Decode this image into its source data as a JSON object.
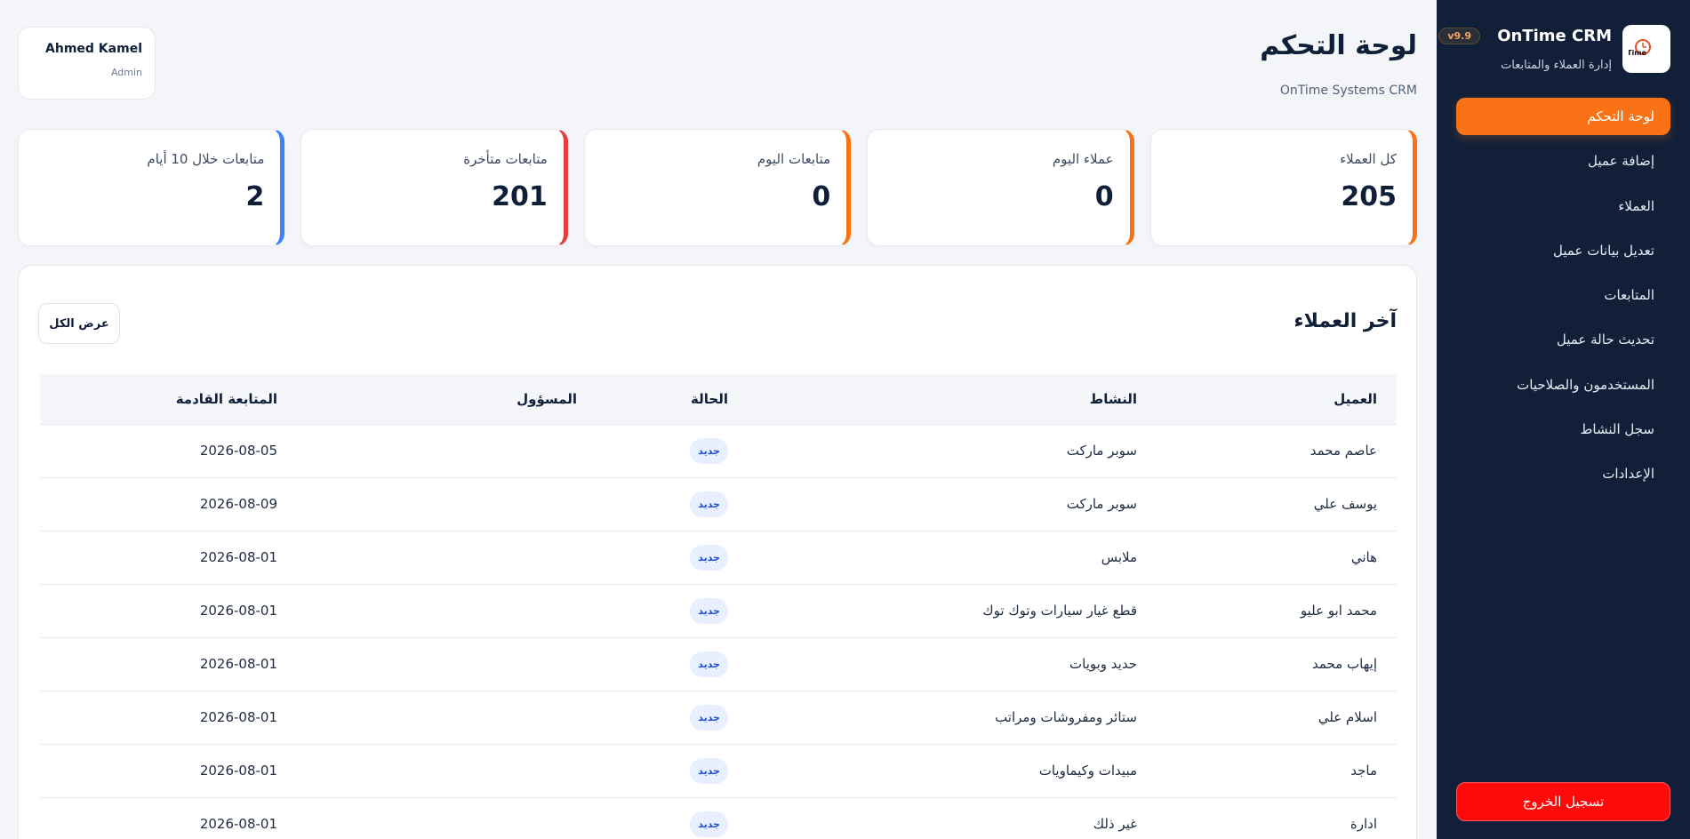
{
  "sidebar": {
    "brand_name": "OnTime CRM",
    "version": "v9.9",
    "subtitle": "إدارة العملاء والمتابعات",
    "logo_text": "Time",
    "items": [
      {
        "label": "لوحة التحكم",
        "active": true
      },
      {
        "label": "إضافة عميل"
      },
      {
        "label": "العملاء"
      },
      {
        "label": "تعديل بيانات عميل"
      },
      {
        "label": "المتابعات"
      },
      {
        "label": "تحديث حالة عميل"
      },
      {
        "label": "المستخدمون والصلاحيات"
      },
      {
        "label": "سجل النشاط"
      },
      {
        "label": "الإعدادات"
      }
    ],
    "logout_label": "تسجيل الخروج"
  },
  "header": {
    "title": "لوحة التحكم",
    "subtitle": "OnTime Systems CRM",
    "user": {
      "name": "Ahmed Kamel",
      "role": "Admin"
    }
  },
  "stats": [
    {
      "label": "كل العملاء",
      "value": "205"
    },
    {
      "label": "عملاء اليوم",
      "value": "0"
    },
    {
      "label": "متابعات اليوم",
      "value": "0"
    },
    {
      "label": "متابعات متأخرة",
      "value": "201"
    },
    {
      "label": "متابعات خلال 10 أيام",
      "value": "2"
    }
  ],
  "recent": {
    "title": "آخر العملاء",
    "view_all": "عرض الكل",
    "columns": [
      "العميل",
      "النشاط",
      "الحالة",
      "المسؤول",
      "المتابعة القادمة"
    ],
    "rows": [
      {
        "client": "عاصم محمد",
        "activity": "سوبر ماركت",
        "status": "جديد",
        "owner": "",
        "next": "2026-08-05"
      },
      {
        "client": "يوسف علي",
        "activity": "سوبر ماركت",
        "status": "جديد",
        "owner": "",
        "next": "2026-08-09"
      },
      {
        "client": "هاني",
        "activity": "ملابس",
        "status": "جديد",
        "owner": "",
        "next": "2026-08-01"
      },
      {
        "client": "محمد ابو عليو",
        "activity": "قطع غيار سيارات وتوك توك",
        "status": "جديد",
        "owner": "",
        "next": "2026-08-01"
      },
      {
        "client": "إيهاب محمد",
        "activity": "حديد وبويات",
        "status": "جديد",
        "owner": "",
        "next": "2026-08-01"
      },
      {
        "client": "اسلام علي",
        "activity": "ستائر ومفروشات ومراتب",
        "status": "جديد",
        "owner": "",
        "next": "2026-08-01"
      },
      {
        "client": "ماجد",
        "activity": "مبيدات وكيماويات",
        "status": "جديد",
        "owner": "",
        "next": "2026-08-01"
      },
      {
        "client": "ادارة",
        "activity": "غير ذلك",
        "status": "جديد",
        "owner": "",
        "next": "2026-08-01"
      }
    ]
  },
  "colors": {
    "sidebar_bg": "#112038",
    "accent": "#f97316",
    "danger": "#e53e3e",
    "info": "#3b82f6",
    "logout": "#ff0a0a"
  }
}
